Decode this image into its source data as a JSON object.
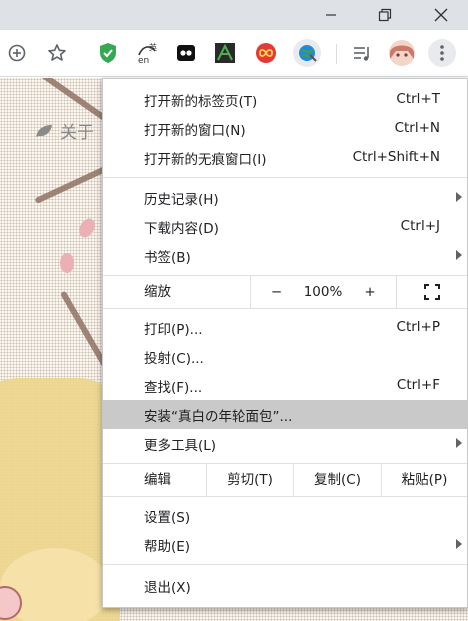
{
  "window": {
    "minimize_icon": "minimize-icon",
    "restore_icon": "restore-icon",
    "close_icon": "close-icon"
  },
  "toolbar": {
    "icons": [
      "add-circle-icon",
      "star-icon",
      "shield-extension-icon",
      "translate-extension-icon",
      "face-extension-icon",
      "plant-extension-icon",
      "infinity-extension-icon",
      "globe-extension-icon",
      "media-queue-icon",
      "profile-avatar",
      "more-vert-icon"
    ]
  },
  "page": {
    "about_text": "关于"
  },
  "menu": {
    "new_tab": {
      "label": "打开新的标签页(T)",
      "shortcut": "Ctrl+T"
    },
    "new_window": {
      "label": "打开新的窗口(N)",
      "shortcut": "Ctrl+N"
    },
    "new_incognito": {
      "label": "打开新的无痕窗口(I)",
      "shortcut": "Ctrl+Shift+N"
    },
    "history": {
      "label": "历史记录(H)"
    },
    "downloads": {
      "label": "下载内容(D)",
      "shortcut": "Ctrl+J"
    },
    "bookmarks": {
      "label": "书签(B)"
    },
    "zoom": {
      "label": "缩放",
      "minus": "−",
      "value": "100%",
      "plus": "+"
    },
    "print": {
      "label": "打印(P)...",
      "shortcut": "Ctrl+P"
    },
    "cast": {
      "label": "投射(C)..."
    },
    "find": {
      "label": "查找(F)...",
      "shortcut": "Ctrl+F"
    },
    "install": {
      "label": "安装“真白の年轮面包”..."
    },
    "more_tools": {
      "label": "更多工具(L)"
    },
    "edit": {
      "label": "编辑",
      "cut": "剪切(T)",
      "copy": "复制(C)",
      "paste": "粘贴(P)"
    },
    "settings": {
      "label": "设置(S)"
    },
    "help": {
      "label": "帮助(E)"
    },
    "exit": {
      "label": "退出(X)"
    }
  },
  "colors": {
    "highlight": "#c9c9c9",
    "titlebar": "#dee1e6"
  }
}
